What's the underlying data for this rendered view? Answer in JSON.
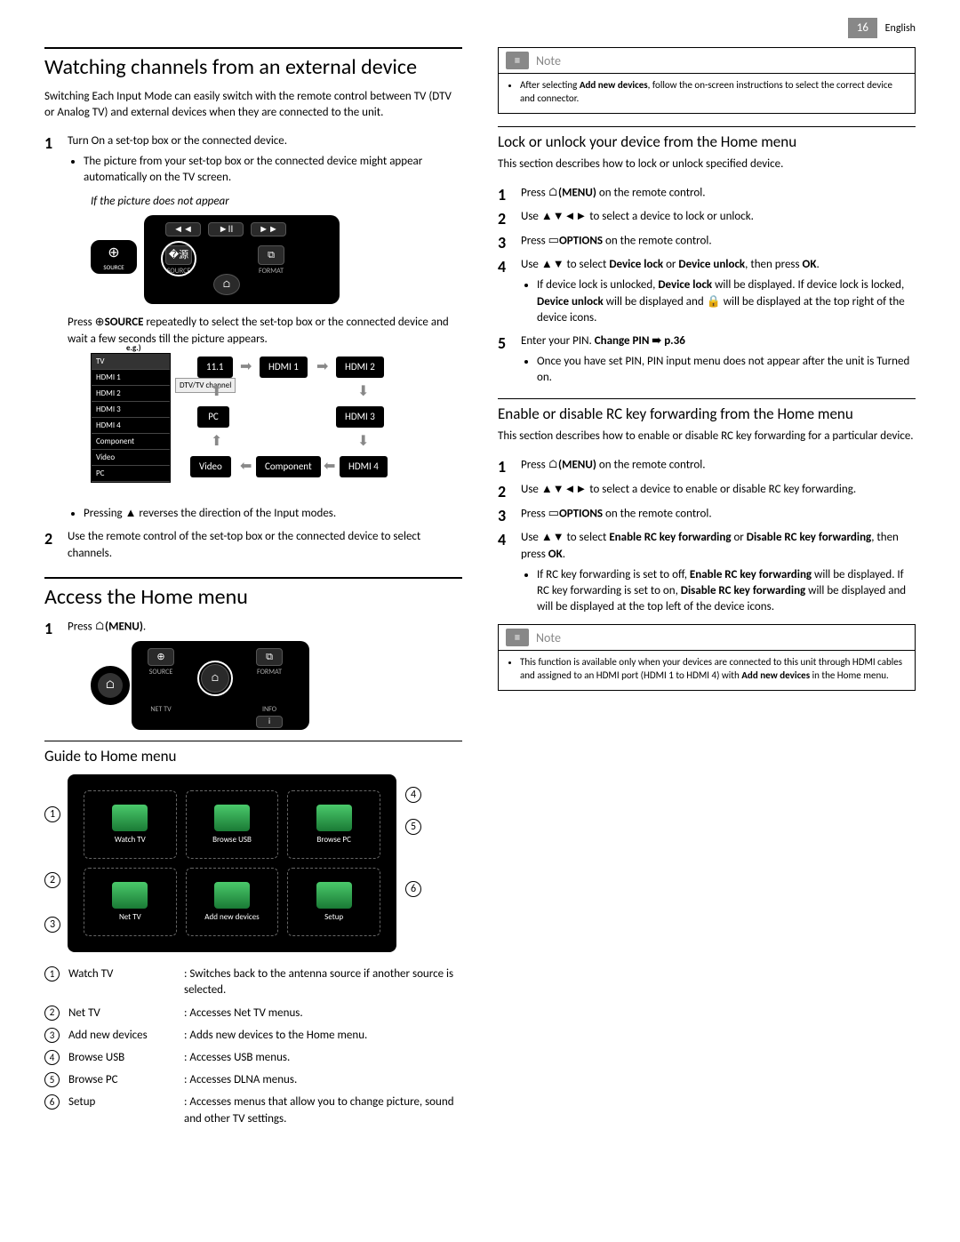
{
  "page": {
    "number": "16",
    "lang": "English"
  },
  "left": {
    "h1": "Watching channels from an external device",
    "intro": "Switching Each Input Mode can easily switch with the remote control between TV (DTV or Analog TV) and external devices when they are connected to the unit.",
    "step1": "Turn On a set-top box or the connected device.",
    "step1_bullet": "The picture from your set-top box or the connected device might appear automatically on the TV screen.",
    "sub_italic": "If the picture does not appear",
    "remote": {
      "source_label": "SOURCE",
      "btn_source": "SOURCE",
      "btn_format": "FORMAT"
    },
    "press_source_pre": "Press ",
    "press_source_bold": "SOURCE",
    "press_source_post": " repeatedly to select the set-top box or the connected device and wait a few seconds till the picture appears.",
    "eg": "e.g.)",
    "flow": {
      "list": [
        "TV",
        "HDMI 1",
        "HDMI 2",
        "HDMI 3",
        "HDMI 4",
        "Component",
        "Video",
        "PC"
      ],
      "dtv": "DTV/TV channel",
      "b11": "11.1",
      "hdmi1": "HDMI 1",
      "hdmi2": "HDMI 2",
      "hdmi3": "HDMI 3",
      "hdmi4": "HDMI 4",
      "pc": "PC",
      "video": "Video",
      "component": "Component"
    },
    "pressing_triangle": "Pressing ▲ reverses the direction of the Input modes.",
    "step2": "Use the remote control of the set-top box or the connected device to select channels.",
    "h1b": "Access the Home menu",
    "access_step1_pre": "Press ",
    "access_step1_bold": "(MENU)",
    "remote2": {
      "source": "SOURCE",
      "format": "FORMAT",
      "nettv": "NET TV",
      "info": "INFO"
    },
    "guide_h2": "Guide to Home menu",
    "tiles": {
      "t1": "Watch TV",
      "t2": "Browse USB",
      "t3": "Browse PC",
      "t4": "Net TV",
      "t5": "Add new devices",
      "t6": "Setup"
    },
    "legend": [
      {
        "n": "1",
        "name": "Watch TV",
        "desc": ": Switches back to the antenna source if another source is selected."
      },
      {
        "n": "2",
        "name": "Net TV",
        "desc": ": Accesses Net TV menus."
      },
      {
        "n": "3",
        "name": "Add new devices",
        "desc": ": Adds new devices to the Home menu."
      },
      {
        "n": "4",
        "name": "Browse USB",
        "desc": ": Accesses USB menus."
      },
      {
        "n": "5",
        "name": "Browse PC",
        "desc": ": Accesses DLNA menus."
      },
      {
        "n": "6",
        "name": "Setup",
        "desc": ": Accesses menus that allow you to change picture, sound and other TV settings."
      }
    ]
  },
  "right": {
    "note1_title": "Note",
    "note1_pre": "After selecting ",
    "note1_bold": "Add new devices",
    "note1_post": ", follow the on-screen instructions to select the correct device and connector.",
    "lock_h2": "Lock or unlock your device from the Home menu",
    "lock_intro": "This section describes how to lock or unlock specified device.",
    "lock_s1_pre": "Press ",
    "lock_s1_bold": "(MENU)",
    "lock_s1_post": " on the remote control.",
    "lock_s2": "Use ▲▼◄► to select a device to lock or unlock.",
    "lock_s3_pre": "Press ",
    "lock_s3_bold": "OPTIONS",
    "lock_s3_post": " on the remote control.",
    "lock_s4_pre": "Use ▲▼ to select ",
    "lock_s4_b1": "Device lock",
    "lock_s4_mid": " or ",
    "lock_s4_b2": "Device unlock",
    "lock_s4_post": ", then press ",
    "lock_s4_b3": "OK",
    "lock_s4_end": ".",
    "lock_s4_bullet_pre": "If device lock is unlocked, ",
    "lock_s4_bullet_b1": "Device lock",
    "lock_s4_bullet_mid": " will be displayed. If device lock is locked, ",
    "lock_s4_bullet_b2": "Device unlock",
    "lock_s4_bullet_post": " will be displayed and 🔒 will be displayed at the top right of the device icons.",
    "lock_s5_pre": "Enter your PIN. ",
    "lock_s5_bold": "Change PIN ➠ p.36",
    "lock_s5_bullet": "Once you have set PIN, PIN input menu does not appear after the unit is Turned on.",
    "rc_h2": "Enable or disable RC key forwarding from the Home menu",
    "rc_intro": "This section describes how to enable or disable RC key forwarding for a particular device.",
    "rc_s1_pre": "Press ",
    "rc_s1_bold": "(MENU)",
    "rc_s1_post": " on the remote control.",
    "rc_s2": "Use ▲▼◄► to select a device to enable or disable RC key forwarding.",
    "rc_s3_pre": "Press ",
    "rc_s3_bold": "OPTIONS",
    "rc_s3_post": " on the remote control.",
    "rc_s4_pre": "Use ▲▼ to select ",
    "rc_s4_b1": "Enable RC key forwarding",
    "rc_s4_mid": " or ",
    "rc_s4_b2": "Disable RC key forwarding",
    "rc_s4_post": ", then press ",
    "rc_s4_b3": "OK",
    "rc_s4_end": ".",
    "rc_s4_bullet_pre": "If RC key forwarding is set to off, ",
    "rc_s4_bullet_b1": "Enable RC key forwarding",
    "rc_s4_bullet_mid": " will be displayed. If RC key forwarding is set to on, ",
    "rc_s4_bullet_b2": "Disable RC key forwarding",
    "rc_s4_bullet_post": " will be displayed and  will be displayed at the top left of the device icons.",
    "note2_title": "Note",
    "note2_text_pre": "This function is available only when your devices are connected to this unit through HDMI cables and assigned to an HDMI port (HDMI 1 to HDMI 4) with ",
    "note2_bold": "Add new devices",
    "note2_text_post": " in the Home menu."
  }
}
